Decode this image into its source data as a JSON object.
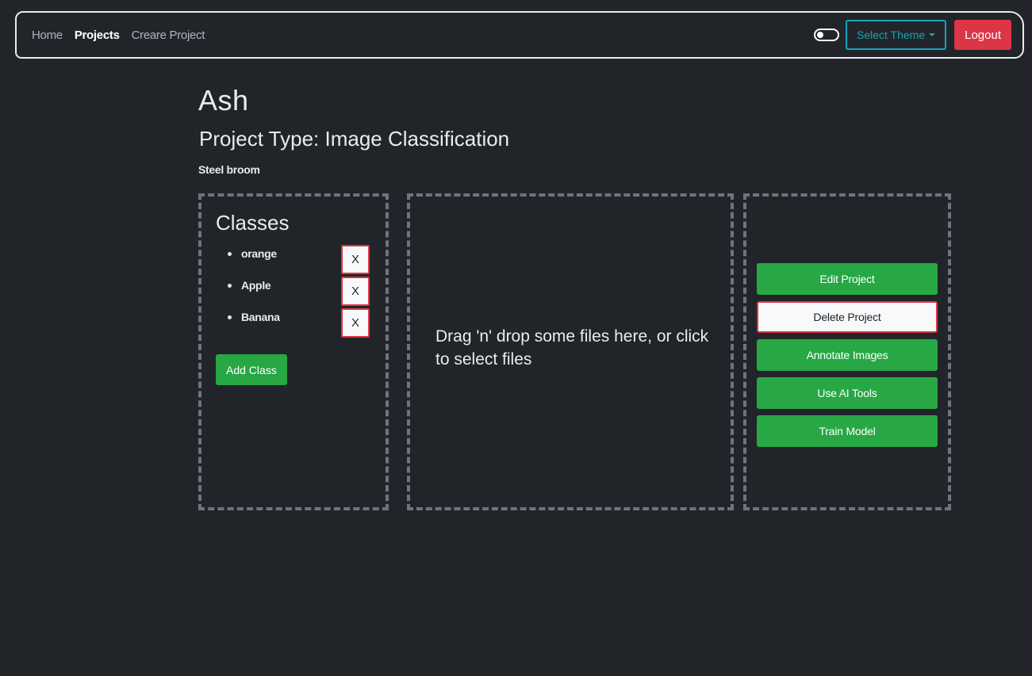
{
  "nav": {
    "links": [
      {
        "label": "Home"
      },
      {
        "label": "Projects"
      },
      {
        "label": "Creare Project"
      }
    ],
    "theme_label": "Select Theme",
    "logout_label": "Logout"
  },
  "project": {
    "title": "Ash",
    "type_text": "Project Type: Image Classification",
    "description": "Steel broom"
  },
  "classes": {
    "heading": "Classes",
    "items": [
      {
        "name": "orange",
        "remove_label": "X"
      },
      {
        "name": "Apple",
        "remove_label": "X"
      },
      {
        "name": "Banana",
        "remove_label": "X"
      }
    ],
    "add_label": "Add Class"
  },
  "dropzone": {
    "text": "Drag 'n' drop some files here, or click to select files"
  },
  "actions": {
    "edit": "Edit Project",
    "delete": "Delete Project",
    "annotate": "Annotate Images",
    "ai_tools": "Use AI Tools",
    "train": "Train Model"
  },
  "colors": {
    "background": "#212529",
    "success": "#28a745",
    "danger": "#dc3545",
    "info": "#17a2b8",
    "panel_border": "#6c757d"
  }
}
